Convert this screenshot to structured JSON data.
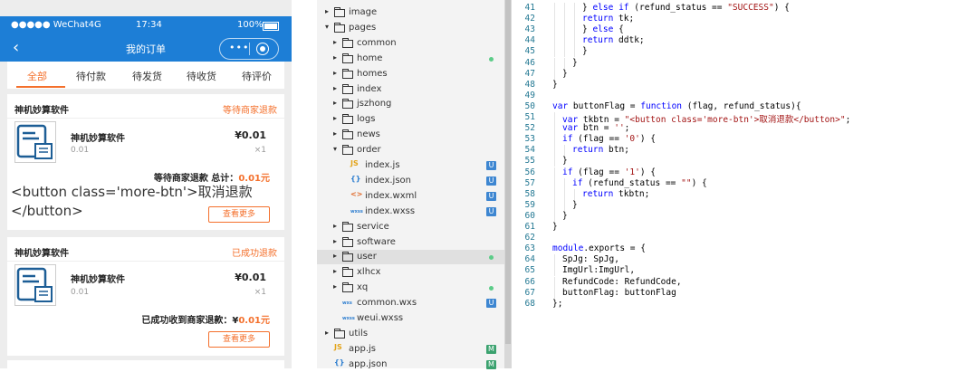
{
  "phone": {
    "status_bar": {
      "carrier": "●●●●● WeChat4G",
      "time": "17:34",
      "battery": "100%"
    },
    "nav_bar": {
      "back": "‹",
      "title": "我的订单",
      "more": "•••"
    },
    "tabs": [
      "全部",
      "待付款",
      "待发货",
      "待收货",
      "待评价"
    ],
    "orders": [
      {
        "shop": "神机妙算软件",
        "status": "等待商家退款",
        "product_name": "神机妙算软件",
        "product_small_price": "0.01",
        "price": "¥0.01",
        "qty": "×1",
        "summary_label": "等待商家退款 总计：",
        "summary_amount": "0.01元",
        "more_button": "查看更多"
      },
      {
        "shop": "神机妙算软件",
        "status": "已成功退款",
        "product_name": "神机妙算软件",
        "product_small_price": "0.01",
        "price": "¥0.01",
        "qty": "×1",
        "summary_label": "已成功收到商家退款：¥",
        "summary_amount": "0.01元",
        "more_button": "查看更多"
      }
    ],
    "raw_text": "<button class='more-btn'>取消退款</button>"
  },
  "explorer": {
    "items": [
      {
        "label": "image",
        "type": "folder"
      },
      {
        "label": "pages",
        "type": "folder-open"
      },
      {
        "label": "common",
        "type": "folder"
      },
      {
        "label": "home",
        "type": "folder"
      },
      {
        "label": "homes",
        "type": "folder"
      },
      {
        "label": "index",
        "type": "folder"
      },
      {
        "label": "jszhong",
        "type": "folder"
      },
      {
        "label": "logs",
        "type": "folder"
      },
      {
        "label": "news",
        "type": "folder"
      },
      {
        "label": "order",
        "type": "folder-open"
      },
      {
        "label": "index.js",
        "type": "js",
        "badge": "U"
      },
      {
        "label": "index.json",
        "type": "json",
        "badge": "U"
      },
      {
        "label": "index.wxml",
        "type": "wxml",
        "badge": "U"
      },
      {
        "label": "index.wxss",
        "type": "wxss",
        "badge": "U"
      },
      {
        "label": "service",
        "type": "folder"
      },
      {
        "label": "software",
        "type": "folder"
      },
      {
        "label": "user",
        "type": "folder"
      },
      {
        "label": "xlhcx",
        "type": "folder"
      },
      {
        "label": "xq",
        "type": "folder"
      },
      {
        "label": "common.wxs",
        "type": "wxs",
        "badge": "U"
      },
      {
        "label": "weui.wxss",
        "type": "wxss"
      },
      {
        "label": "utils",
        "type": "folder"
      },
      {
        "label": "app.js",
        "type": "js",
        "badge": "M"
      },
      {
        "label": "app.json",
        "type": "json",
        "badge": "M"
      }
    ],
    "icons": {
      "js": "JS",
      "json": "{}",
      "wxml": "<>",
      "wxss": "wxss",
      "wxs": "wxs"
    },
    "colors": {
      "badge_u": "#3d86d1",
      "badge_m": "#3ba26f",
      "dot": "#5ccc88"
    }
  },
  "editor": {
    "line_numbers": [
      "41",
      "42",
      "43",
      "44",
      "45",
      "46",
      "47",
      "48",
      "49",
      "50",
      "51",
      "52",
      "53",
      "54",
      "55",
      "56",
      "57",
      "58",
      "59",
      "60",
      "61",
      "62",
      "63",
      "64",
      "65",
      "66",
      "67",
      "68"
    ],
    "lines": [
      "} else if (refund_status == \"SUCCESS\") {",
      "return tk;",
      "} else {",
      "return ddtk;",
      "}",
      "}",
      "}",
      "}",
      "",
      "var buttonFlag = function (flag, refund_status){",
      "var tkbtn = \"<button class='more-btn'>取消退款</button>\";",
      "var btn = '';",
      "if (flag == '0') {",
      "return btn;",
      "}",
      "if (flag == '1') {",
      "if (refund_status == \"\") {",
      "return tkbtn;",
      "}",
      "}",
      "}",
      "",
      "module.exports = {",
      "SpJg: SpJg,",
      "ImgUrl:ImgUrl,",
      "RefundCode: RefundCode,",
      "buttonFlag: buttonFlag",
      "};"
    ]
  },
  "colors": {
    "accent": "#1d7ed6",
    "orange": "#f4702c",
    "keyword": "#0000ff",
    "string": "#a31515",
    "line_number": "#237893"
  }
}
